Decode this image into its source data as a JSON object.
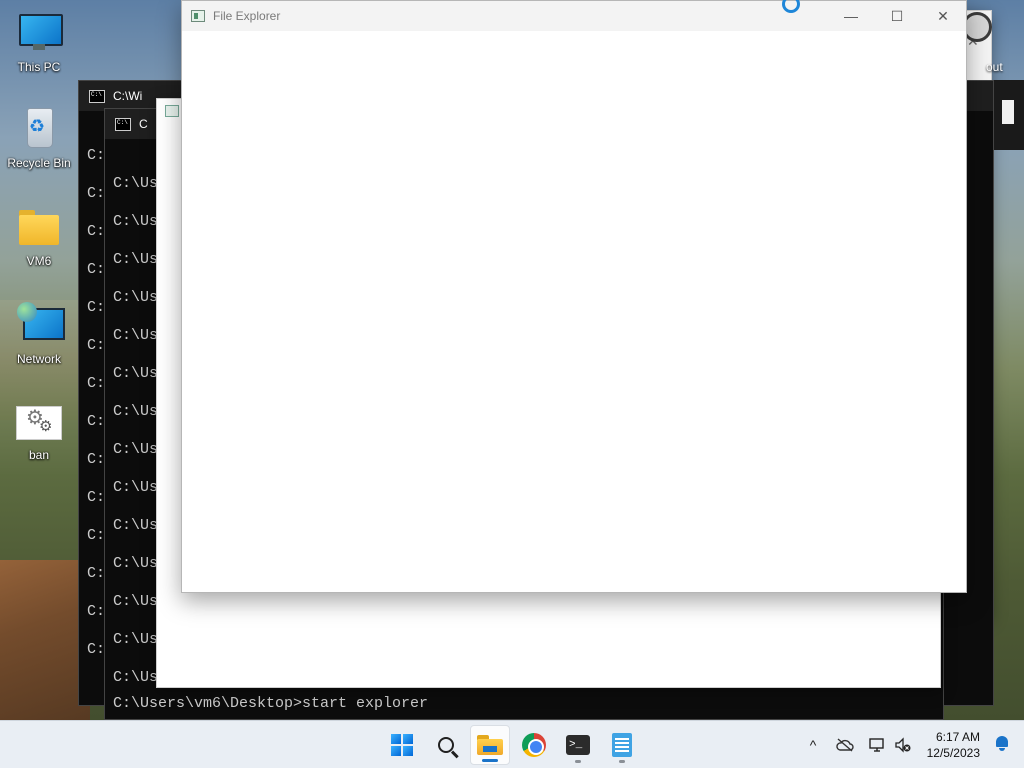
{
  "desktop": {
    "icons": [
      {
        "label": "This PC",
        "icon": "this-pc-icon"
      },
      {
        "label": "Recycle Bin",
        "icon": "recycle-bin-icon"
      },
      {
        "label": "VM6",
        "icon": "folder-icon"
      },
      {
        "label": "Network",
        "icon": "network-icon"
      },
      {
        "label": "ban",
        "icon": "settings-shortcut-icon"
      }
    ]
  },
  "console_back": {
    "title": "C:\\Wi",
    "prompt": "C:",
    "line_count": 14
  },
  "console_front": {
    "title": "C",
    "partial_prompt": "C:\\Us",
    "last_command": "C:\\Users\\vm6\\Desktop>start explorer"
  },
  "right_window": {
    "label_fragment": "out"
  },
  "file_explorer": {
    "title": "File Explorer",
    "minimize": "—",
    "maximize": "☐",
    "close": "✕"
  },
  "taskbar": {
    "items": [
      {
        "name": "start-button",
        "icon": "windows-logo-icon"
      },
      {
        "name": "search-button",
        "icon": "search-icon"
      },
      {
        "name": "file-explorer-button",
        "icon": "file-explorer-icon",
        "active": true
      },
      {
        "name": "chrome-button",
        "icon": "chrome-icon"
      },
      {
        "name": "terminal-button",
        "icon": "terminal-icon"
      },
      {
        "name": "notepad-button",
        "icon": "notepad-icon"
      }
    ],
    "tray": {
      "chevron": "^",
      "time": "6:17 AM",
      "date": "12/5/2023"
    }
  },
  "colors": {
    "accent": "#1a73c9",
    "console_bg": "#0c0c0c",
    "taskbar_bg": "#e9eef4"
  }
}
